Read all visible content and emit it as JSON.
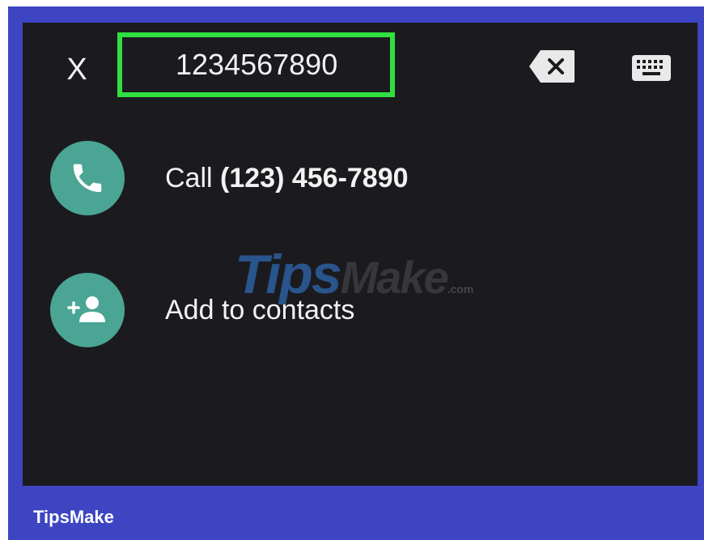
{
  "dialer": {
    "close_label": "X",
    "number_value": "1234567890",
    "colors": {
      "highlight": "#2fe040",
      "accent": "#4aa594",
      "background": "#1b1b1f",
      "frame": "#3d45c2"
    }
  },
  "actions": {
    "call": {
      "prefix": "Call ",
      "number": "(123) 456-7890",
      "icon": "phone-icon"
    },
    "add_contact": {
      "label": "Add to contacts",
      "icon": "add-person-icon"
    }
  },
  "toolbar": {
    "backspace_icon": "backspace-icon",
    "keyboard_icon": "keyboard-icon"
  },
  "watermark": {
    "tips": "Tips",
    "make": "Make",
    "com": ".com"
  },
  "footer": {
    "brand": "TipsMake"
  }
}
